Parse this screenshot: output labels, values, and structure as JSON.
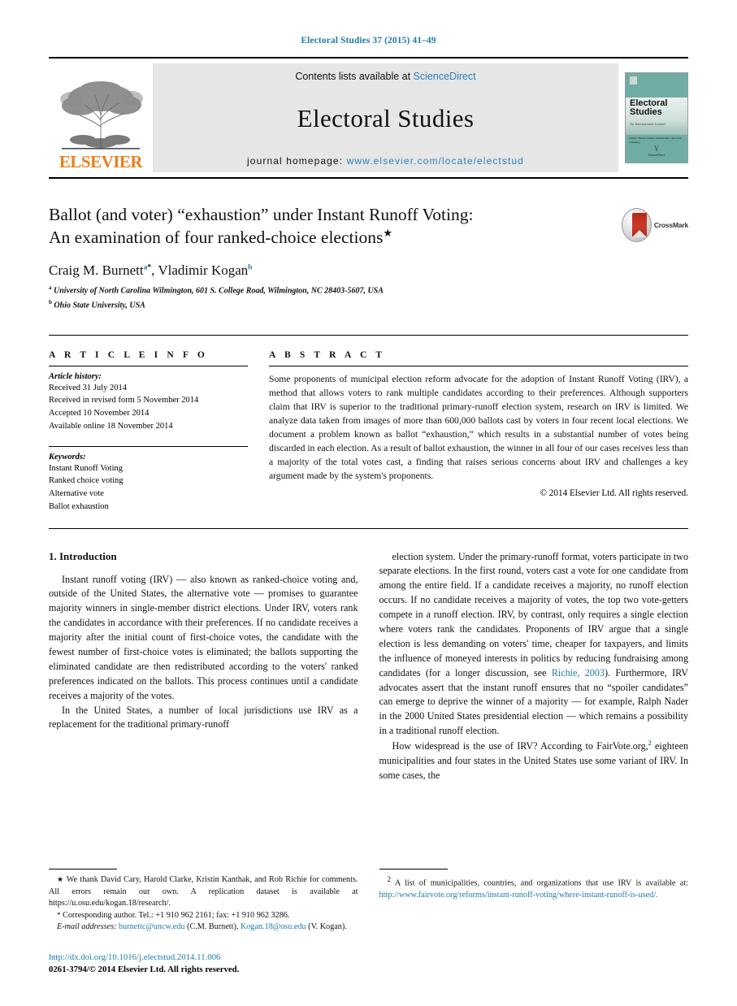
{
  "running_head": "Electoral Studies 37 (2015) 41–49",
  "banner": {
    "contents_prefix": "Contents lists available at ",
    "contents_link": "ScienceDirect",
    "journal_name": "Electoral Studies",
    "homepage_label": "journal homepage: ",
    "homepage_url": "www.elsevier.com/locate/electstud",
    "publisher": "ELSEVIER",
    "cover": {
      "title_line1": "Electoral",
      "title_line2": "Studies",
      "subtitle": "An International Journal",
      "editors": "Editors:\nHarold Clarke, Lindsay Prior and Chris Cumming",
      "logo_mark": "Y",
      "logo_text": "ScienceDirect"
    }
  },
  "article": {
    "title_line1": "Ballot (and voter) “exhaustion” under Instant Runoff Voting:",
    "title_line2": "An examination of four ranked-choice elections",
    "title_star": "★",
    "crossmark_label": "CrossMark",
    "authors": [
      {
        "name": "Craig M. Burnett",
        "sup": "a",
        "sup_star": "*"
      },
      {
        "name": "Vladimir Kogan",
        "sup": "b",
        "sup_star": ""
      }
    ],
    "author_separator": ", ",
    "affiliations": [
      {
        "mark": "a",
        "text": "University of North Carolina Wilmington, 601 S. College Road, Wilmington, NC 28403-5607, USA"
      },
      {
        "mark": "b",
        "text": "Ohio State University, USA"
      }
    ]
  },
  "info": {
    "heading": "A R T I C L E   I N F O",
    "history_label": "Article history:",
    "history": [
      "Received 31 July 2014",
      "Received in revised form 5 November 2014",
      "Accepted 10 November 2014",
      "Available online 18 November 2014"
    ],
    "keywords_label": "Keywords:",
    "keywords": [
      "Instant Runoff Voting",
      "Ranked choice voting",
      "Alternative vote",
      "Ballot exhaustion"
    ]
  },
  "abstract": {
    "heading": "A B S T R A C T",
    "text": "Some proponents of municipal election reform advocate for the adoption of Instant Runoff Voting (IRV), a method that allows voters to rank multiple candidates according to their preferences. Although supporters claim that IRV is superior to the traditional primary-runoff election system, research on IRV is limited. We analyze data taken from images of more than 600,000 ballots cast by voters in four recent local elections. We document a problem known as ballot “exhaustion,” which results in a substantial number of votes being discarded in each election. As a result of ballot exhaustion, the winner in all four of our cases receives less than a majority of the total votes cast, a finding that raises serious concerns about IRV and challenges a key argument made by the system's proponents.",
    "copyright": "© 2014 Elsevier Ltd. All rights reserved."
  },
  "body": {
    "section_heading": "1. Introduction",
    "left_para_1": "Instant runoff voting (IRV) — also known as ranked-choice voting and, outside of the United States, the alternative vote — promises to guarantee majority winners in single-member district elections. Under IRV, voters rank the candidates in accordance with their preferences. If no candidate receives a majority after the initial count of first-choice votes, the candidate with the fewest number of first-choice votes is eliminated; the ballots supporting the eliminated candidate are then redistributed according to the voters' ranked preferences indicated on the ballots. This process continues until a candidate receives a majority of the votes.",
    "left_para_2": "In the United States, a number of local jurisdictions use IRV as a replacement for the traditional primary-runoff",
    "right_para_1_a": "election system. Under the primary-runoff format, voters participate in two separate elections. In the first round, voters cast a vote for one candidate from among the entire field. If a candidate receives a majority, no runoff election occurs. If no candidate receives a majority of votes, the top two vote-getters compete in a runoff election. IRV, by contrast, only requires a single election where voters rank the candidates. Proponents of IRV argue that a single election is less demanding on voters' time, cheaper for taxpayers, and limits the influence of moneyed interests in politics by reducing fundraising among candidates (for a longer discussion, see ",
    "right_para_1_link": "Richie, 2003",
    "right_para_1_b": "). Furthermore, IRV advocates assert that the instant runoff ensures that no “spoiler candidates” can emerge to deprive the winner of a majority — for example, Ralph Nader in the 2000 United States presidential election — which remains a possibility in a traditional runoff election.",
    "right_para_2_a": "How widespread is the use of IRV? According to FairVote.org,",
    "right_para_2_ref": "2",
    "right_para_2_b": " eighteen municipalities and four states in the United States use some variant of IRV. In some cases, the"
  },
  "footnotes": {
    "left": {
      "star_mark": "★",
      "star_text": " We thank David Cary, Harold Clarke, Kristin Kanthak, and Rob Richie for comments. All errors remain our own. A replication dataset is available at https://u.osu.edu/kogan.18/research/.",
      "corr_mark": "*",
      "corr_text": " Corresponding author. Tel.: +1 910 962 2161; fax: +1 910 962 3286.",
      "email_label": "E-mail addresses:",
      "email_1": "burnettc@uncw.edu",
      "email_1_owner": " (C.M. Burnett), ",
      "email_2": "Kogan.18@osu.edu",
      "email_2_owner": " (V. Kogan)."
    },
    "right": {
      "mark": "2",
      "text": " A list of municipalities, countries, and organizations that use IRV is available at: ",
      "url": "http://www.fairvote.org/reforms/instant-runoff-voting/where-instant-runoff-is-used/."
    }
  },
  "doi": {
    "url": "http://dx.doi.org/10.1016/j.electstud.2014.11.006",
    "issn_line": "0261-3794/© 2014 Elsevier Ltd. All rights reserved."
  },
  "colors": {
    "link": "#1f7ba6",
    "sciencedirect": "#2980b9",
    "elsevier_orange": "#ED7D1A",
    "cover_teal": "#6fada4"
  }
}
